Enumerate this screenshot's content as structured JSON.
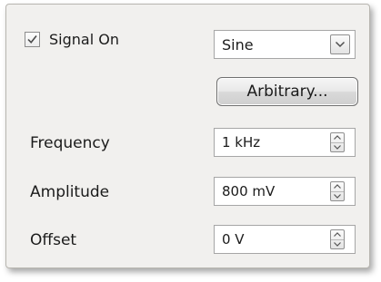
{
  "signal": {
    "checkbox_checked": true,
    "label": "Signal On"
  },
  "waveform": {
    "selected": "Sine",
    "arbitrary_button": "Arbitrary..."
  },
  "fields": {
    "frequency": {
      "label": "Frequency",
      "value": "1 kHz"
    },
    "amplitude": {
      "label": "Amplitude",
      "value": "800 mV"
    },
    "offset": {
      "label": "Offset",
      "value": "0 V"
    }
  },
  "icons": {
    "checkbox_check": "check-icon",
    "dropdown": "chevron-down-icon",
    "spin_up": "arrow-up-icon",
    "spin_down": "arrow-down-icon"
  },
  "colors": {
    "panel_background": "#f1f0ee",
    "border": "#a6a6a6",
    "text": "#1b1b1b"
  }
}
